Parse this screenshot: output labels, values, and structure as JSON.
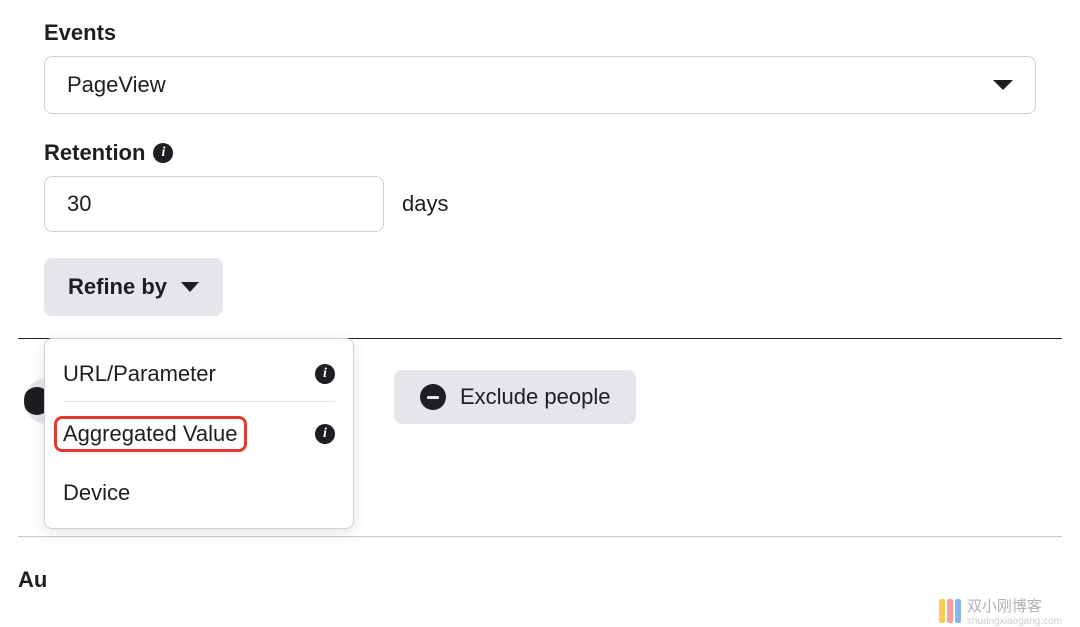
{
  "events": {
    "label": "Events",
    "selected": "PageView"
  },
  "retention": {
    "label": "Retention",
    "value": "30",
    "unit": "days"
  },
  "refine": {
    "button_label": "Refine by",
    "options": {
      "url_parameter": "URL/Parameter",
      "aggregated_value": "Aggregated Value",
      "device": "Device"
    }
  },
  "exclude": {
    "button_label": "Exclude people"
  },
  "audience": {
    "partial_label": "Au"
  },
  "watermark": {
    "text": "双小刚博客",
    "sub": "shuangxiaogang.com"
  }
}
